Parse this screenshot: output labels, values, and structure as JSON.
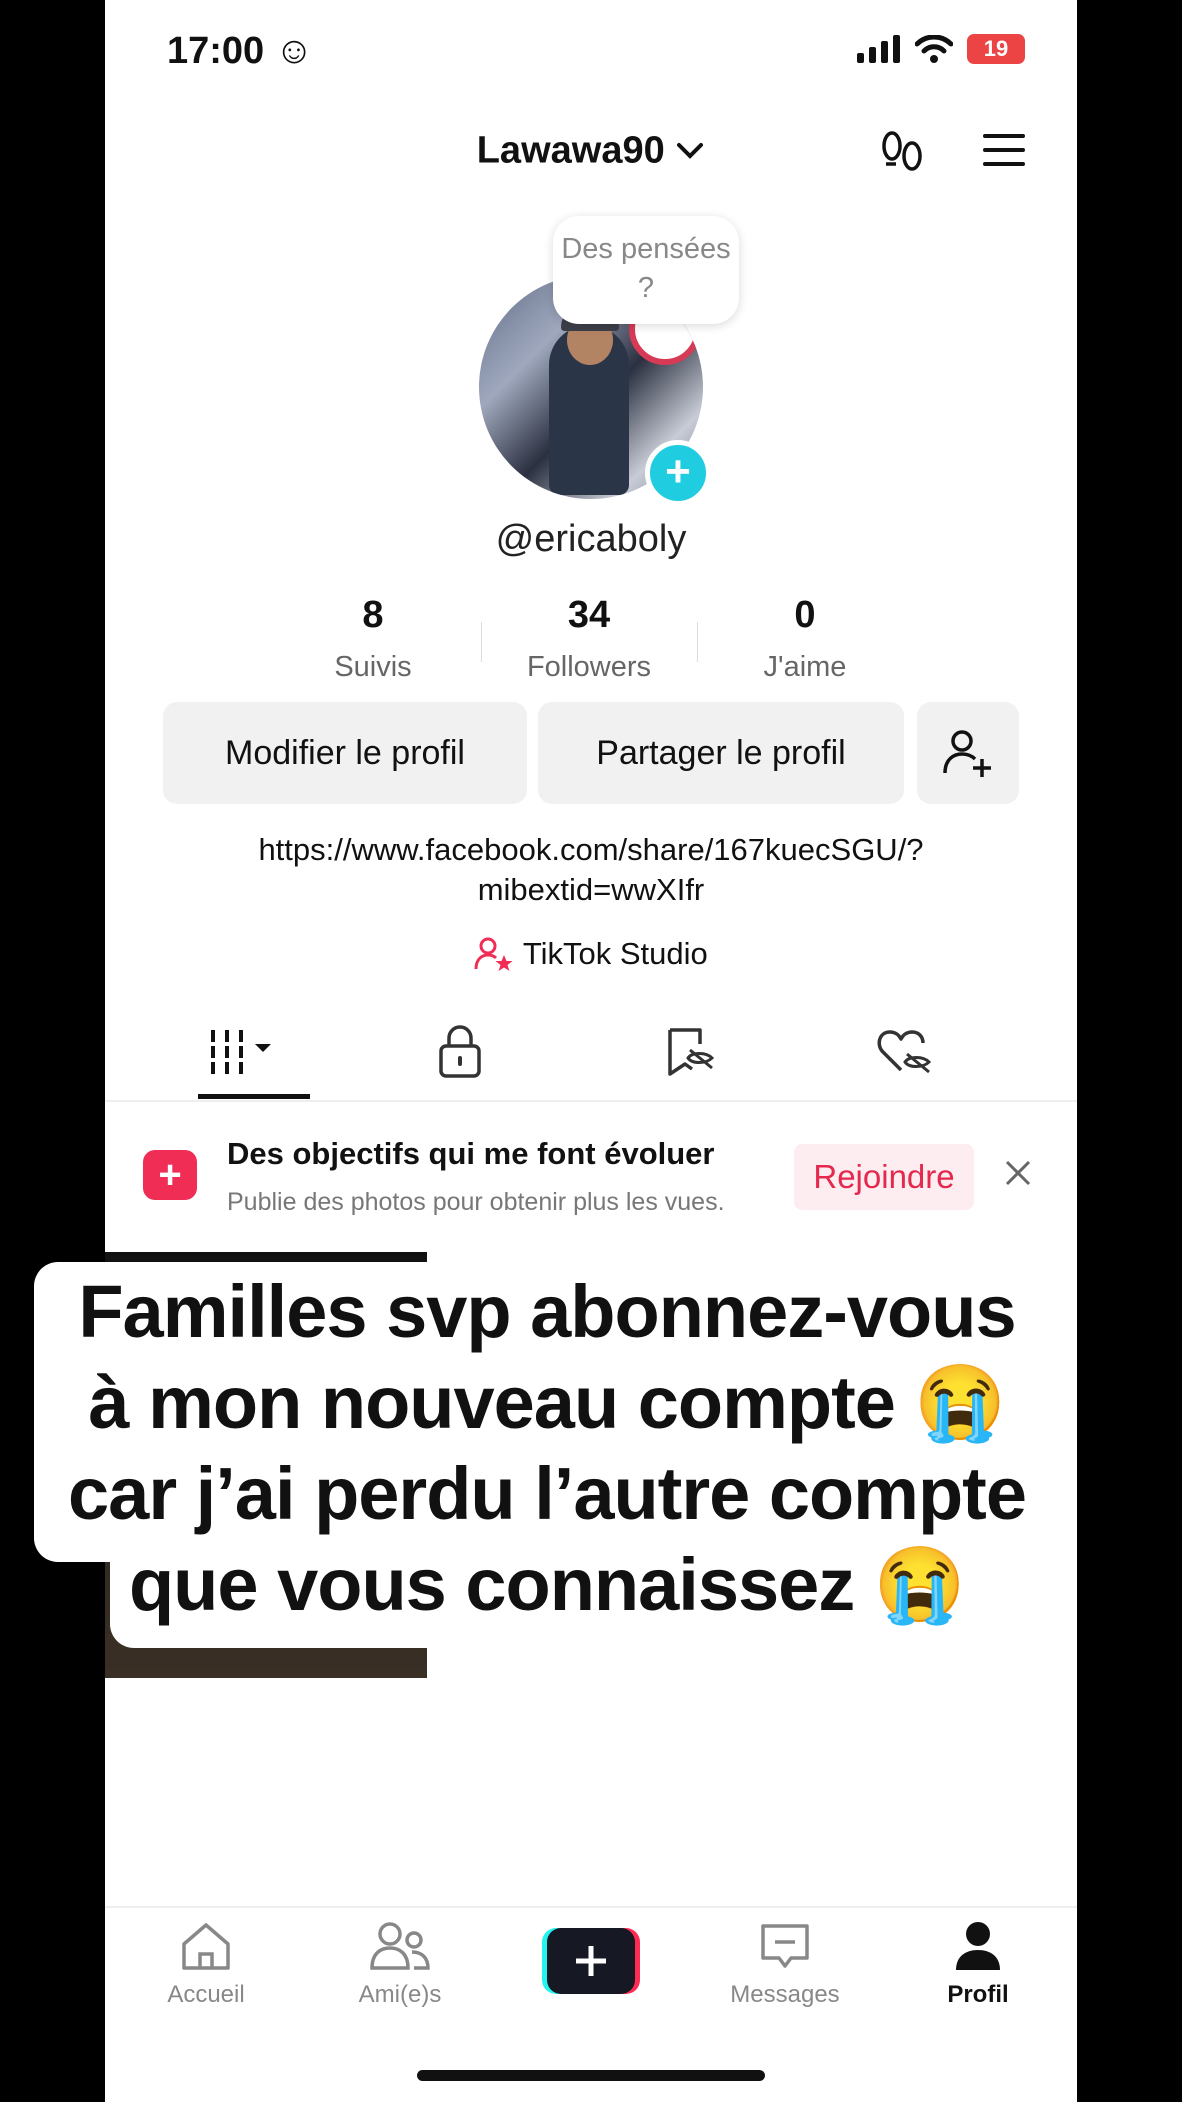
{
  "status": {
    "time": "17:00 ☺",
    "battery": "19"
  },
  "header": {
    "username": "Lawawa90"
  },
  "profile": {
    "bubble": "Des pensées ?",
    "handle": "@ericaboly",
    "stats": [
      {
        "value": "8",
        "label": "Suivis"
      },
      {
        "value": "34",
        "label": "Followers"
      },
      {
        "value": "0",
        "label": "J'aime"
      }
    ],
    "edit_label": "Modifier le profil",
    "share_label": "Partager le profil",
    "link_line1": "https://www.facebook.com/share/167kuecSGU/?",
    "link_line2": "mibextid=wwXIfr",
    "studio_label": "TikTok Studio"
  },
  "banner": {
    "title": "Des objectifs qui me font évoluer",
    "subtitle": "Publie des photos pour obtenir plus les vues.",
    "join_label": "Rejoindre"
  },
  "overlay": {
    "line1": "Familles svp abonnez-vous",
    "line2": "à mon nouveau compte 😭",
    "line3": "car j’ai perdu l’autre compte",
    "line4": "que vous connaissez 😭"
  },
  "nav": {
    "home": "Accueil",
    "friends": "Ami(e)s",
    "messages": "Messages",
    "profile": "Profil"
  },
  "colors": {
    "accent": "#f02d55",
    "teal": "#20cde0"
  }
}
